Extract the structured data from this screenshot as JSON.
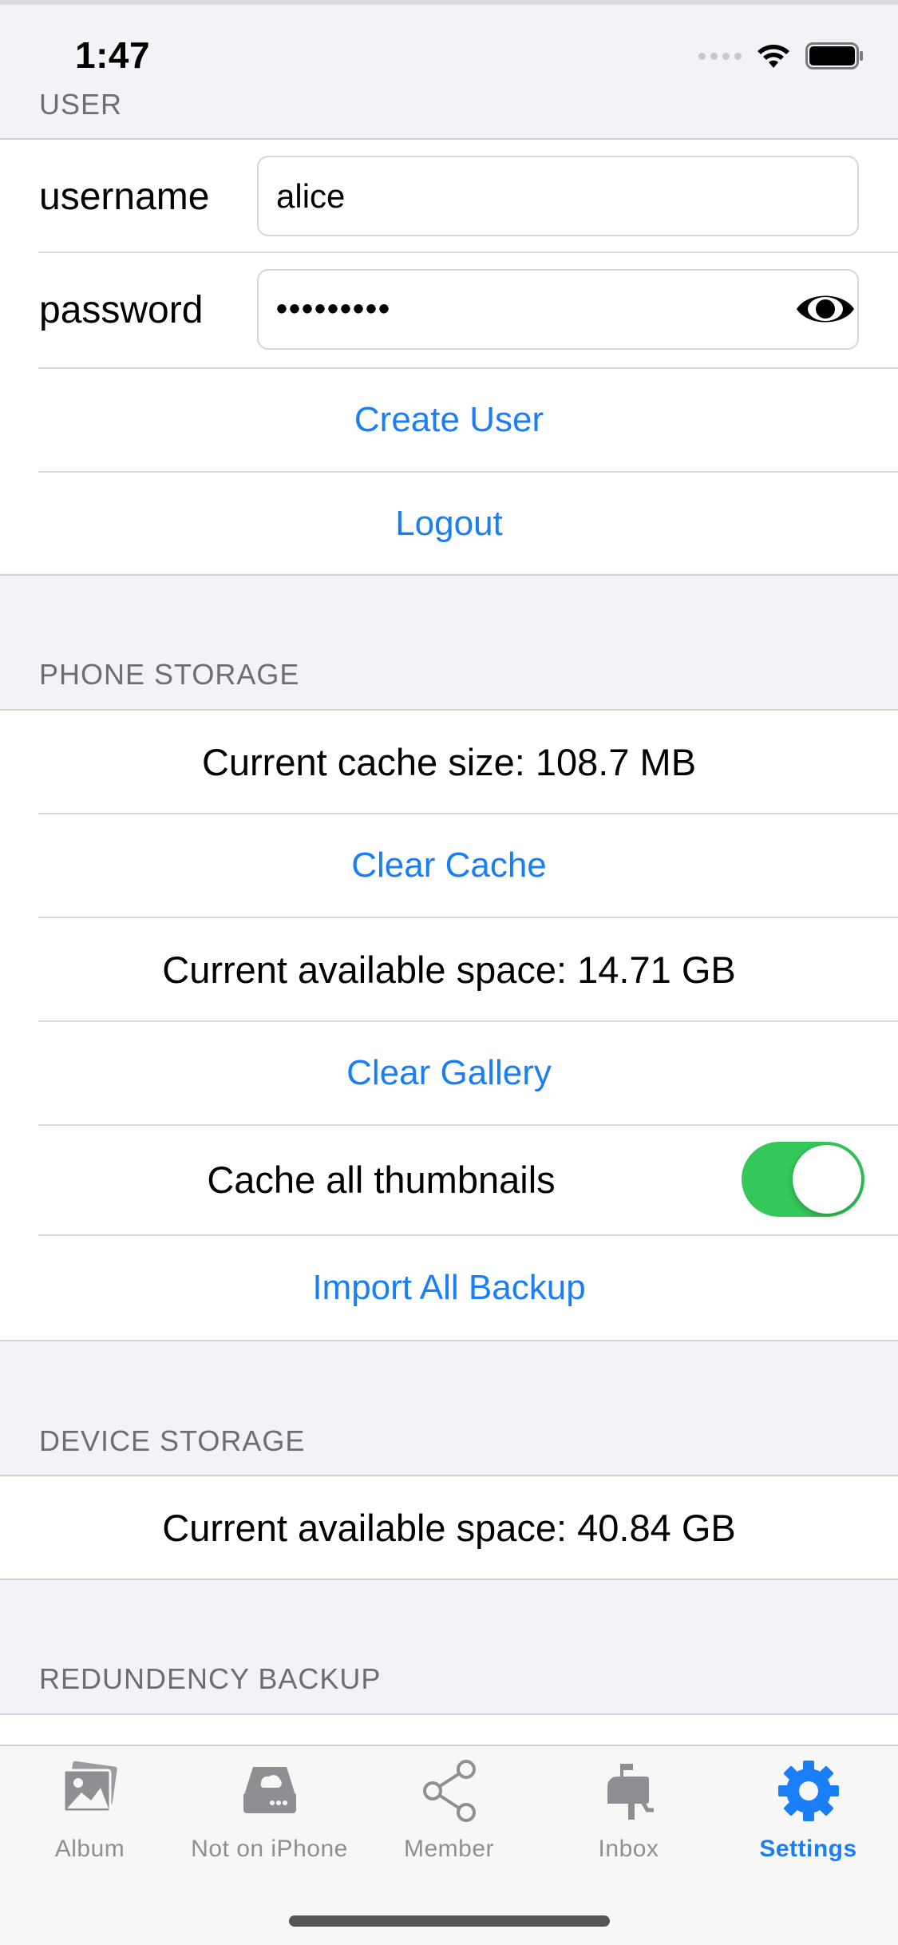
{
  "status_bar": {
    "time": "1:47"
  },
  "user": {
    "header": "USER",
    "username_label": "username",
    "username_value": "alice",
    "password_label": "password",
    "password_masked": "•••••••••",
    "create_user": "Create User",
    "logout": "Logout"
  },
  "phone_storage": {
    "header": "PHONE STORAGE",
    "cache_size": "Current cache size: 108.7 MB",
    "clear_cache": "Clear Cache",
    "available_space": "Current available space: 14.71 GB",
    "clear_gallery": "Clear Gallery",
    "cache_thumbnails_label": "Cache all thumbnails",
    "cache_thumbnails_on": true,
    "import_all_backup": "Import All Backup"
  },
  "device_storage": {
    "header": "DEVICE STORAGE",
    "available_space": "Current available space: 40.84 GB"
  },
  "redundancy_backup": {
    "header": "REDUNDENCY BACKUP"
  },
  "tabbar": {
    "tabs": [
      {
        "label": "Album",
        "icon": "album-icon",
        "active": false
      },
      {
        "label": "Not on iPhone",
        "icon": "drive-icon",
        "active": false
      },
      {
        "label": "Member",
        "icon": "share-icon",
        "active": false
      },
      {
        "label": "Inbox",
        "icon": "mailbox-icon",
        "active": false
      },
      {
        "label": "Settings",
        "icon": "gear-icon",
        "active": true
      }
    ]
  },
  "colors": {
    "accent": "#1a7ef7",
    "toggle_on": "#34c759",
    "background": "#f2f2f7",
    "inactive_tab": "#8e8e93"
  }
}
